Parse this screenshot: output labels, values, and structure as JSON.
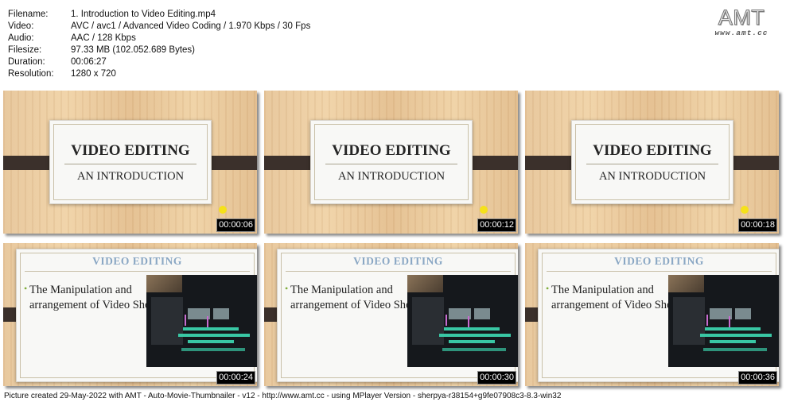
{
  "info": [
    {
      "key": "Filename:",
      "value": "1. Introduction to Video Editing.mp4"
    },
    {
      "key": "Video:",
      "value": "AVC / avc1 / Advanced Video Coding / 1.970 Kbps / 30 Fps"
    },
    {
      "key": "Audio:",
      "value": "AAC / 128 Kbps"
    },
    {
      "key": "Filesize:",
      "value": "97.33 MB (102.052.689 Bytes)"
    },
    {
      "key": "Duration:",
      "value": "00:06:27"
    },
    {
      "key": "Resolution:",
      "value": "1280 x 720"
    }
  ],
  "logo": {
    "main": "AMT",
    "url": "www.amt.cc"
  },
  "title_slide": {
    "title": "VIDEO EDITING",
    "subtitle": "AN INTRODUCTION"
  },
  "content_slide": {
    "heading": "VIDEO EDITING",
    "bullet": "The Manipulation and arrangement of Video Shots"
  },
  "thumbnails": [
    {
      "timestamp": "00:00:06"
    },
    {
      "timestamp": "00:00:12"
    },
    {
      "timestamp": "00:00:18"
    },
    {
      "timestamp": "00:00:24"
    },
    {
      "timestamp": "00:00:30"
    },
    {
      "timestamp": "00:00:36"
    }
  ],
  "footer": "Picture created 29-May-2022 with AMT - Auto-Movie-Thumbnailer - v12 - http://www.amt.cc - using MPlayer Version - sherpya-r38154+g9fe07908c3-8.3-win32",
  "colors": {
    "band": "#3b302b",
    "heading_blue": "#8aa7c4",
    "bullet_green": "#7fae3a",
    "dot_yellow": "#f5e11a"
  }
}
